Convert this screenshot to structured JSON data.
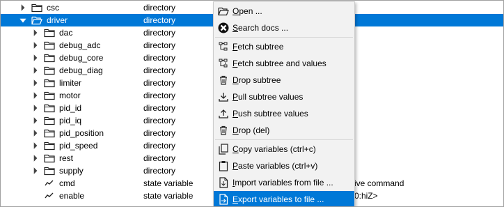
{
  "tree": {
    "rows": [
      {
        "name": "csc",
        "type": "directory",
        "desc": "",
        "kind": "folder",
        "expander": "collapsed",
        "level": 0,
        "selected": false
      },
      {
        "name": "driver",
        "type": "directory",
        "desc": "",
        "kind": "folder",
        "expander": "expanded",
        "level": 0,
        "selected": true
      },
      {
        "name": "dac",
        "type": "directory",
        "desc": "",
        "kind": "folder",
        "expander": "collapsed",
        "level": 1,
        "selected": false
      },
      {
        "name": "debug_adc",
        "type": "directory",
        "desc": "",
        "kind": "folder",
        "expander": "collapsed",
        "level": 1,
        "selected": false
      },
      {
        "name": "debug_core",
        "type": "directory",
        "desc": "",
        "kind": "folder",
        "expander": "collapsed",
        "level": 1,
        "selected": false
      },
      {
        "name": "debug_diag",
        "type": "directory",
        "desc": "",
        "kind": "folder",
        "expander": "collapsed",
        "level": 1,
        "selected": false
      },
      {
        "name": "limiter",
        "type": "directory",
        "desc": "",
        "kind": "folder",
        "expander": "collapsed",
        "level": 1,
        "selected": false
      },
      {
        "name": "motor",
        "type": "directory",
        "desc": "",
        "kind": "folder",
        "expander": "collapsed",
        "level": 1,
        "selected": false
      },
      {
        "name": "pid_id",
        "type": "directory",
        "desc": "",
        "kind": "folder",
        "expander": "collapsed",
        "level": 1,
        "selected": false
      },
      {
        "name": "pid_iq",
        "type": "directory",
        "desc": "",
        "kind": "folder",
        "expander": "collapsed",
        "level": 1,
        "selected": false
      },
      {
        "name": "pid_position",
        "type": "directory",
        "desc": "",
        "kind": "folder",
        "expander": "collapsed",
        "level": 1,
        "selected": false
      },
      {
        "name": "pid_speed",
        "type": "directory",
        "desc": "",
        "kind": "folder",
        "expander": "collapsed",
        "level": 1,
        "selected": false
      },
      {
        "name": "rest",
        "type": "directory",
        "desc": "",
        "kind": "folder",
        "expander": "collapsed",
        "level": 1,
        "selected": false
      },
      {
        "name": "supply",
        "type": "directory",
        "desc": "",
        "kind": "folder",
        "expander": "collapsed",
        "level": 1,
        "selected": false
      },
      {
        "name": "cmd",
        "type": "state variable",
        "desc": "ive command",
        "kind": "variable",
        "expander": "none",
        "level": 1,
        "selected": false
      },
      {
        "name": "enable",
        "type": "state variable",
        "desc": "0:hiZ>",
        "kind": "variable",
        "expander": "none",
        "level": 1,
        "selected": false
      }
    ]
  },
  "context_menu": {
    "items": [
      {
        "label": "Open ...",
        "mnemonic_index": 0,
        "icon": "folder-open-icon",
        "separator_before": false,
        "highlighted": false
      },
      {
        "label": "Search docs ...",
        "mnemonic_index": 0,
        "icon": "search-docs-icon",
        "separator_before": false,
        "highlighted": false
      },
      {
        "label": "Fetch subtree",
        "mnemonic_index": 0,
        "icon": "subtree-icon",
        "separator_before": true,
        "highlighted": false
      },
      {
        "label": "Fetch subtree and values",
        "mnemonic_index": 0,
        "icon": "subtree-values-icon",
        "separator_before": false,
        "highlighted": false
      },
      {
        "label": "Drop subtree",
        "mnemonic_index": 0,
        "icon": "trash-icon",
        "separator_before": false,
        "highlighted": false
      },
      {
        "label": "Pull subtree values",
        "mnemonic_index": 0,
        "icon": "download-icon",
        "separator_before": false,
        "highlighted": false
      },
      {
        "label": "Push subtree values",
        "mnemonic_index": 0,
        "icon": "upload-icon",
        "separator_before": false,
        "highlighted": false
      },
      {
        "label": "Drop (del)",
        "mnemonic_index": 0,
        "icon": "trash-icon",
        "separator_before": false,
        "highlighted": false
      },
      {
        "label": "Copy variables (ctrl+c)",
        "mnemonic_index": 0,
        "icon": "copy-icon",
        "separator_before": true,
        "highlighted": false
      },
      {
        "label": "Paste variables (ctrl+v)",
        "mnemonic_index": 0,
        "icon": "paste-icon",
        "separator_before": false,
        "highlighted": false
      },
      {
        "label": "Import variables from file ...",
        "mnemonic_index": 0,
        "icon": "import-file-icon",
        "separator_before": false,
        "highlighted": false
      },
      {
        "label": "Export variables to file ...",
        "mnemonic_index": 0,
        "icon": "export-file-icon",
        "separator_before": false,
        "highlighted": true
      }
    ]
  },
  "colors": {
    "selection": "#0078d7",
    "menu_background": "#f2f2f2"
  }
}
